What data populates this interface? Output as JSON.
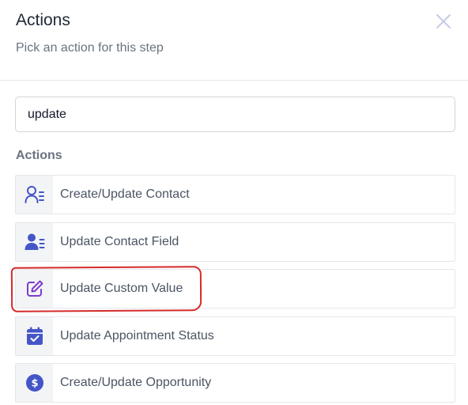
{
  "header": {
    "title": "Actions",
    "subtitle": "Pick an action for this step"
  },
  "search": {
    "value": "update"
  },
  "section": {
    "label": "Actions"
  },
  "actions": [
    {
      "label": "Create/Update Contact",
      "icon": "contact-lines-icon"
    },
    {
      "label": "Update Contact Field",
      "icon": "contact-filled-icon"
    },
    {
      "label": "Update Custom Value",
      "icon": "edit-square-icon"
    },
    {
      "label": "Update Appointment Status",
      "icon": "calendar-check-icon"
    },
    {
      "label": "Create/Update Opportunity",
      "icon": "dollar-circle-icon"
    }
  ],
  "colors": {
    "accent_blue": "#4456c7",
    "accent_purple": "#7e3bd0",
    "annotation_red": "#d62a2a"
  }
}
